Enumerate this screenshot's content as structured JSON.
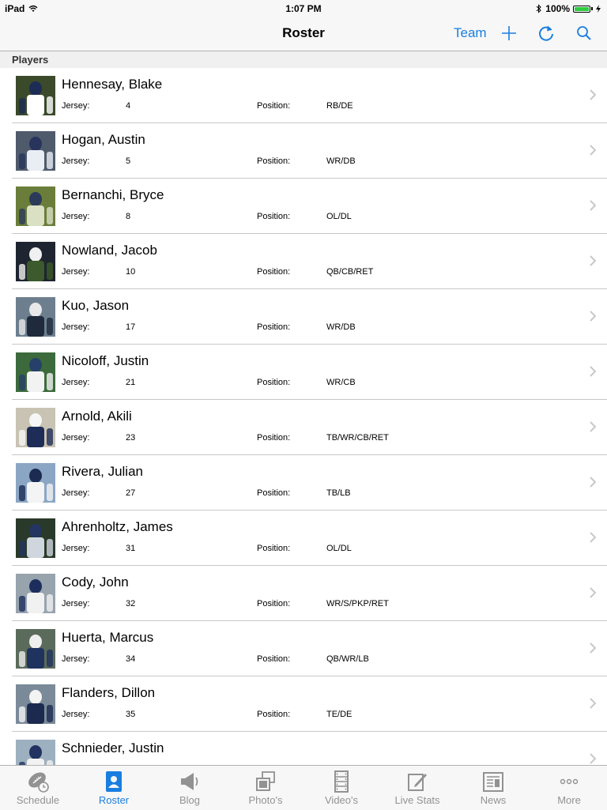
{
  "status_bar": {
    "device": "iPad",
    "time": "1:07 PM",
    "battery": "100%",
    "battery_level": 1.0
  },
  "nav": {
    "title": "Roster",
    "team_label": "Team"
  },
  "section": {
    "title": "Players"
  },
  "players": [
    {
      "name": "Hennesay, Blake",
      "jersey_label": "Jersey:",
      "jersey": "4",
      "position_label": "Position:",
      "position": "RB/DE"
    },
    {
      "name": "Hogan, Austin",
      "jersey_label": "Jersey:",
      "jersey": "5",
      "position_label": "Position:",
      "position": "WR/DB"
    },
    {
      "name": "Bernanchi, Bryce",
      "jersey_label": "Jersey:",
      "jersey": "8",
      "position_label": "Position:",
      "position": "OL/DL"
    },
    {
      "name": "Nowland, Jacob",
      "jersey_label": "Jersey:",
      "jersey": "10",
      "position_label": "Position:",
      "position": "QB/CB/RET"
    },
    {
      "name": "Kuo, Jason",
      "jersey_label": "Jersey:",
      "jersey": "17",
      "position_label": "Position:",
      "position": "WR/DB"
    },
    {
      "name": "Nicoloff, Justin",
      "jersey_label": "Jersey:",
      "jersey": "21",
      "position_label": "Position:",
      "position": "WR/CB"
    },
    {
      "name": "Arnold, Akili",
      "jersey_label": "Jersey:",
      "jersey": "23",
      "position_label": "Position:",
      "position": "TB/WR/CB/RET"
    },
    {
      "name": "Rivera, Julian",
      "jersey_label": "Jersey:",
      "jersey": "27",
      "position_label": "Position:",
      "position": "TB/LB"
    },
    {
      "name": "Ahrenholtz, James",
      "jersey_label": "Jersey:",
      "jersey": "31",
      "position_label": "Position:",
      "position": "OL/DL"
    },
    {
      "name": "Cody, John",
      "jersey_label": "Jersey:",
      "jersey": "32",
      "position_label": "Position:",
      "position": "WR/S/PKP/RET"
    },
    {
      "name": "Huerta, Marcus",
      "jersey_label": "Jersey:",
      "jersey": "34",
      "position_label": "Position:",
      "position": "QB/WR/LB"
    },
    {
      "name": "Flanders, Dillon",
      "jersey_label": "Jersey:",
      "jersey": "35",
      "position_label": "Position:",
      "position": "TE/DE"
    },
    {
      "name": "Schnieder, Justin",
      "jersey_label": "",
      "jersey": "",
      "position_label": "",
      "position": ""
    }
  ],
  "tabs": [
    {
      "label": "Schedule",
      "icon": "football-icon",
      "active": false
    },
    {
      "label": "Roster",
      "icon": "roster-icon",
      "active": true
    },
    {
      "label": "Blog",
      "icon": "megaphone-icon",
      "active": false
    },
    {
      "label": "Photo's",
      "icon": "photos-icon",
      "active": false
    },
    {
      "label": "Video's",
      "icon": "film-icon",
      "active": false
    },
    {
      "label": "Live Stats",
      "icon": "edit-icon",
      "active": false
    },
    {
      "label": "News",
      "icon": "newspaper-icon",
      "active": false
    },
    {
      "label": "More",
      "icon": "more-icon",
      "active": false
    }
  ],
  "colors": {
    "accent": "#1a7ee0",
    "inactive": "#929292",
    "separator": "#c8c7cc"
  }
}
